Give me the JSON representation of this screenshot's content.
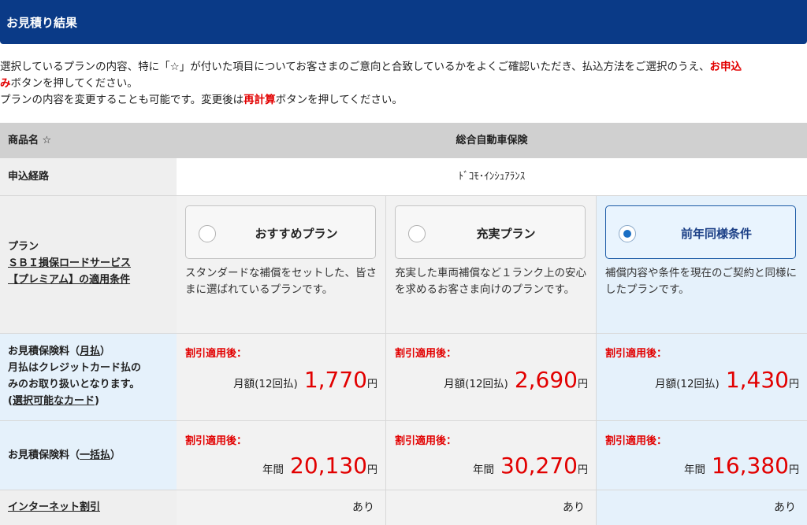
{
  "header": {
    "title": "お見積り結果"
  },
  "intro": {
    "line1a": "選択しているプランの内容、特に「☆」が付いた項目についてお客さまのご意向と合致しているかをよくご確認いただき、払込方法をご選択のうえ、",
    "line1b": "お申込",
    "line2a": "み",
    "line2b": "ボタンを押してください。",
    "line3a": "プランの内容を変更することも可能です。変更後は",
    "line3b": "再計算",
    "line3c": "ボタンを押してください。"
  },
  "product_row": {
    "label": "商品名 ☆",
    "value": "総合自動車保険"
  },
  "route_row": {
    "label": "申込経路",
    "value": "ﾄﾞｺﾓ･ｲﾝｼｭｱﾗﾝｽ"
  },
  "plan_row": {
    "label1": "プラン",
    "label2": "ＳＢＩ損保ロードサービス",
    "label3": "【プレミアム】の適用条件",
    "plans": [
      {
        "name": "おすすめプラン",
        "desc": "スタンダードな補償をセットした、皆さまに選ばれているプランです。",
        "selected": false
      },
      {
        "name": "充実プラン",
        "desc": "充実した車両補償など１ランク上の安心を求めるお客さま向けのプランです。",
        "selected": false
      },
      {
        "name": "前年同様条件",
        "desc": "補償内容や条件を現在のご契約と同様にしたプランです。",
        "selected": true
      }
    ]
  },
  "monthly_row": {
    "l1a": "お見積保険料（",
    "l1b": "月払",
    "l1c": "）",
    "l2": "月払はクレジットカード払の",
    "l3": "みのお取り扱いとなります。",
    "l4a": "(",
    "l4b": "選択可能なカード",
    "l4c": ")",
    "discount": "割引適用後：",
    "prefix": "月額(12回払)",
    "yen": "円",
    "amounts": [
      "1,770",
      "2,690",
      "1,430"
    ]
  },
  "annual_row": {
    "l1a": "お見積保険料（",
    "l1b": "一括払",
    "l1c": "）",
    "discount": "割引適用後：",
    "prefix": "年間",
    "yen": "円",
    "amounts": [
      "20,130",
      "30,270",
      "16,380"
    ]
  },
  "internet_row": {
    "label": "インターネット割引",
    "values": [
      "あり",
      "あり",
      "あり"
    ]
  },
  "colors": {
    "header": "#0a3a87",
    "price": "#e20000",
    "selected_col": "#e5f1fb",
    "radio_on": "#1b6fc4"
  }
}
